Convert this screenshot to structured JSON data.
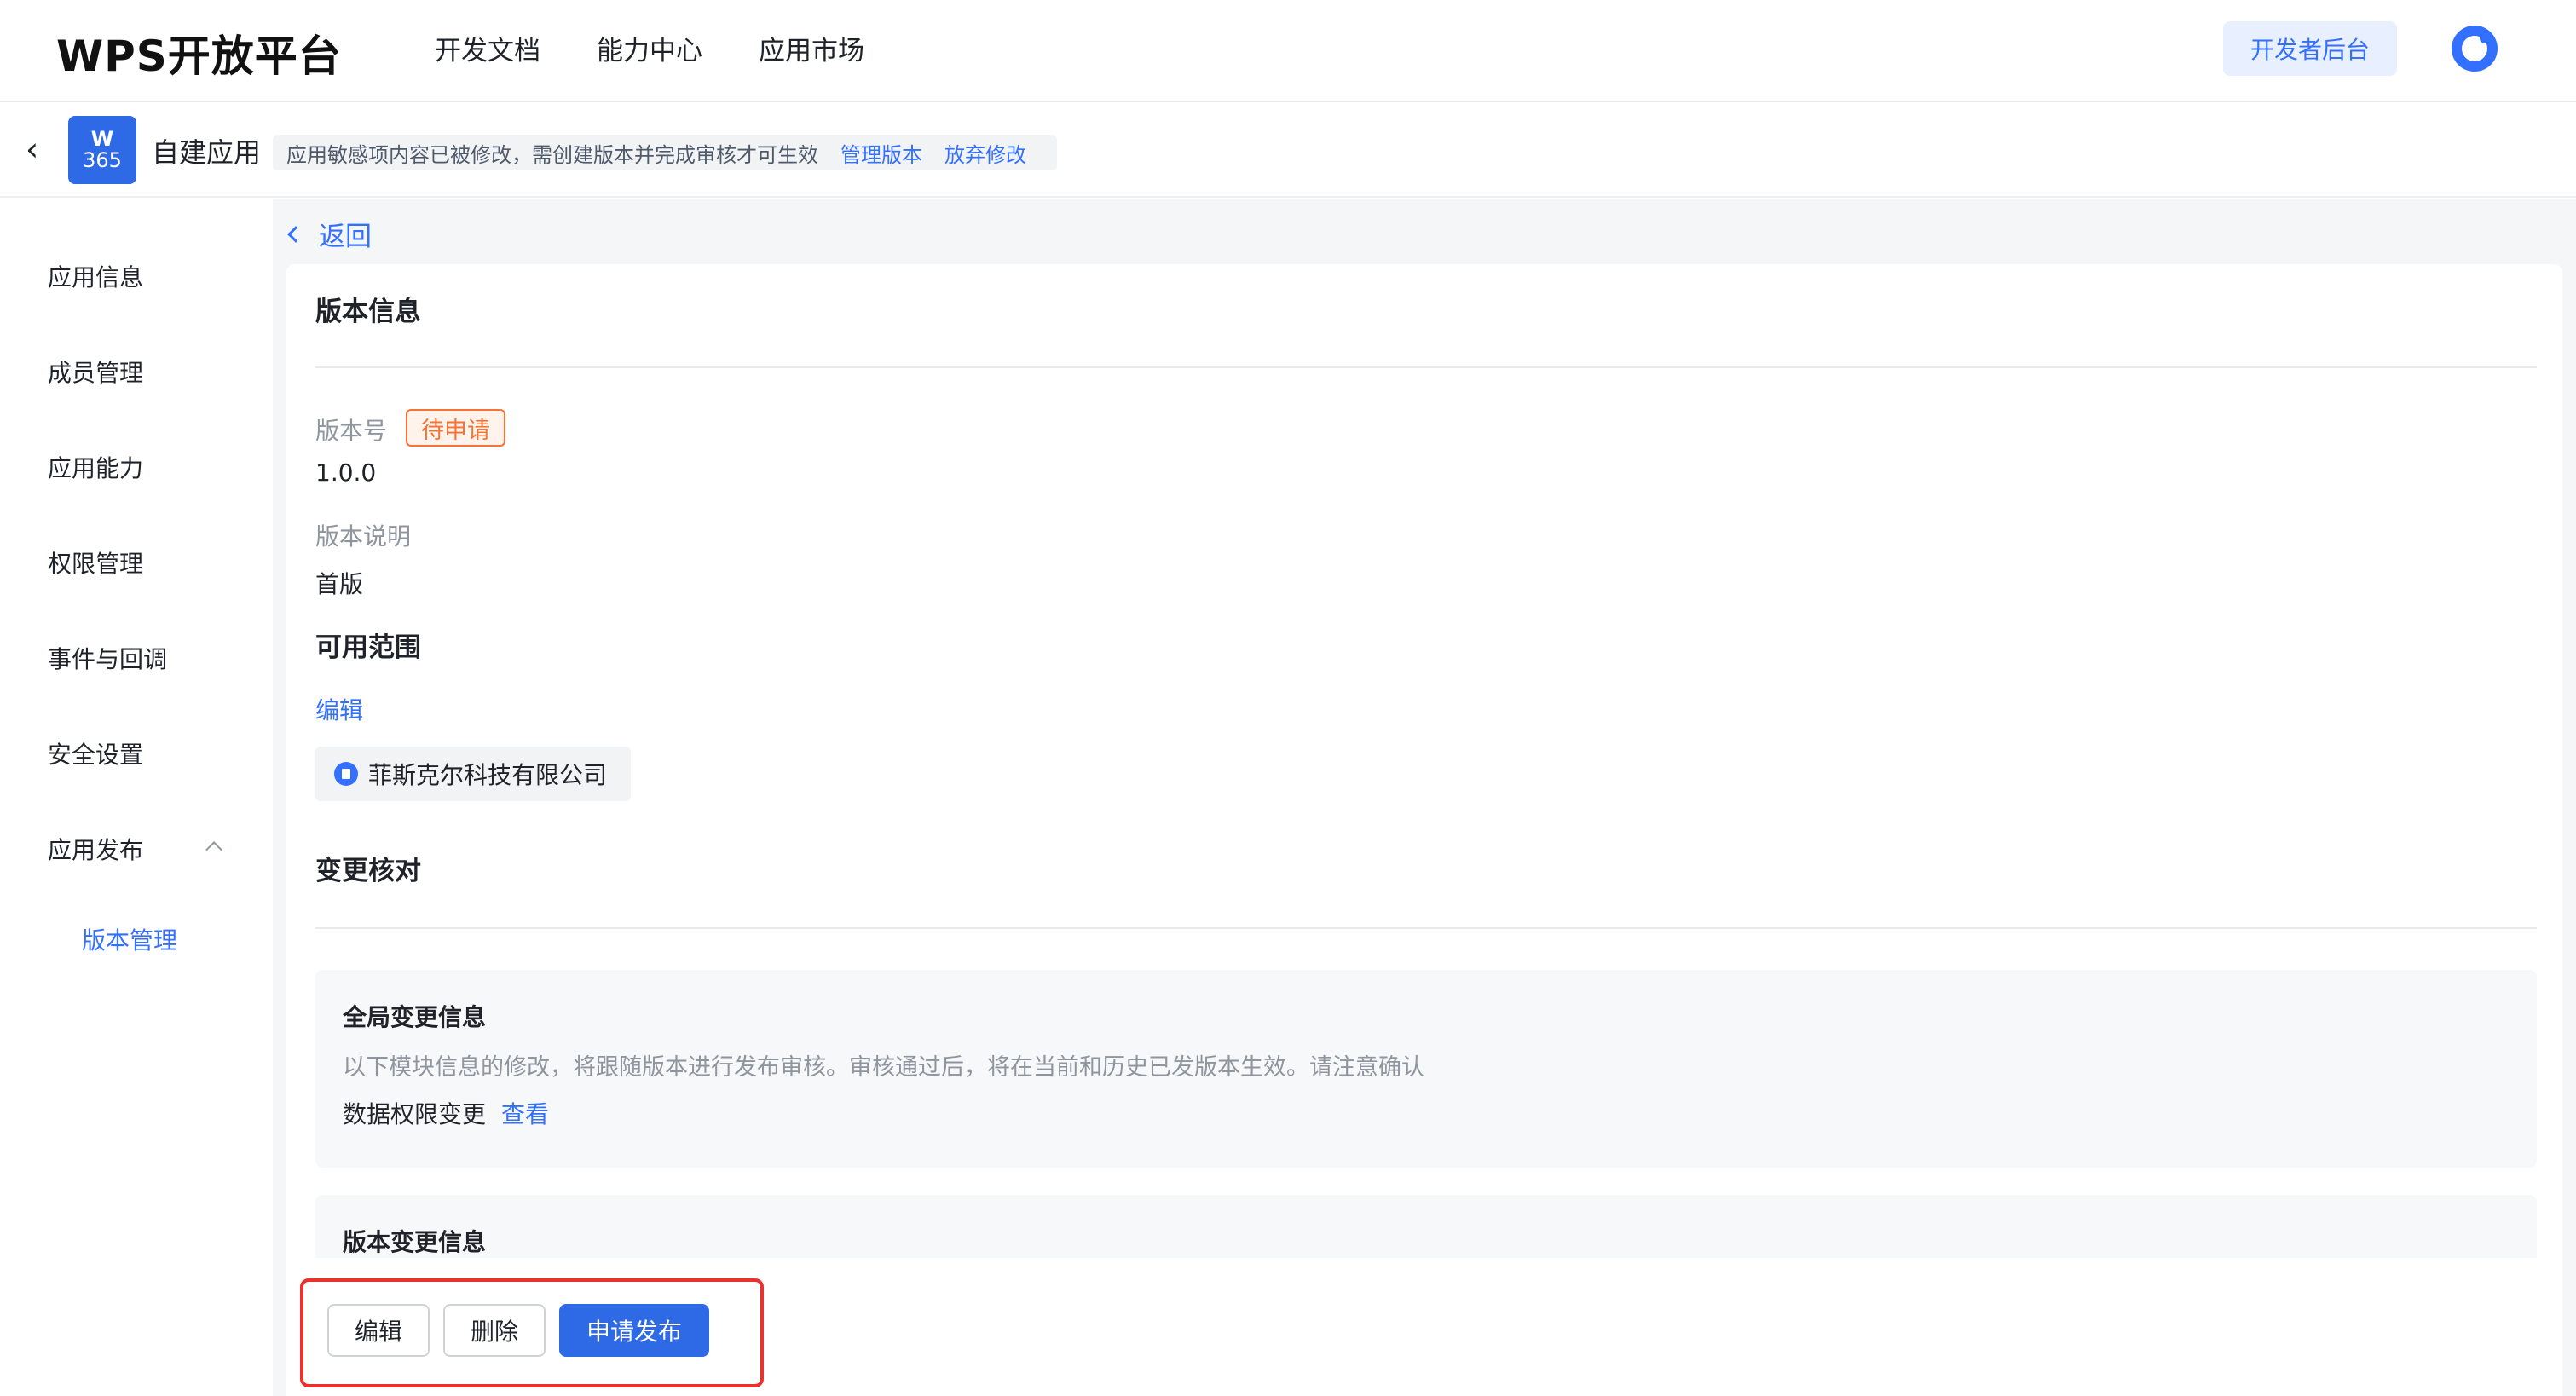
{
  "topnav": {
    "logo": "WPS开放平台",
    "links": [
      "开发文档",
      "能力中心",
      "应用市场"
    ],
    "dev_console": "开发者后台"
  },
  "appbar": {
    "back_icon": "chevron-left-icon",
    "app_icon_top": "W",
    "app_icon_bottom": "365",
    "app_name": "自建应用",
    "notice_text": "应用敏感项内容已被修改，需创建版本并完成审核才可生效",
    "manage_version": "管理版本",
    "discard_changes": "放弃修改"
  },
  "sidebar": {
    "items": [
      "应用信息",
      "成员管理",
      "应用能力",
      "权限管理",
      "事件与回调",
      "安全设置",
      "应用发布"
    ],
    "sub_item": "版本管理"
  },
  "main": {
    "back": "返回",
    "version_info_title": "版本信息",
    "version_number_label": "版本号",
    "status_tag": "待申请",
    "version_number": "1.0.0",
    "version_desc_label": "版本说明",
    "version_desc": "首版",
    "scope_title": "可用范围",
    "scope_edit": "编辑",
    "org_name": "菲斯克尔科技有限公司",
    "change_check_title": "变更核对",
    "global_change": {
      "title": "全局变更信息",
      "desc": "以下模块信息的修改，将跟随版本进行发布审核。审核通过后，将在当前和历史已发版本生效。请注意确认",
      "item": "数据权限变更",
      "view": "查看"
    },
    "version_change_title": "版本变更信息"
  },
  "actions": {
    "edit": "编辑",
    "delete": "删除",
    "apply_publish": "申请发布"
  },
  "colors": {
    "accent": "#3370ff",
    "primary_button": "#2f6ae6",
    "status_orange": "#f77234",
    "highlight_red": "#e8322d"
  }
}
